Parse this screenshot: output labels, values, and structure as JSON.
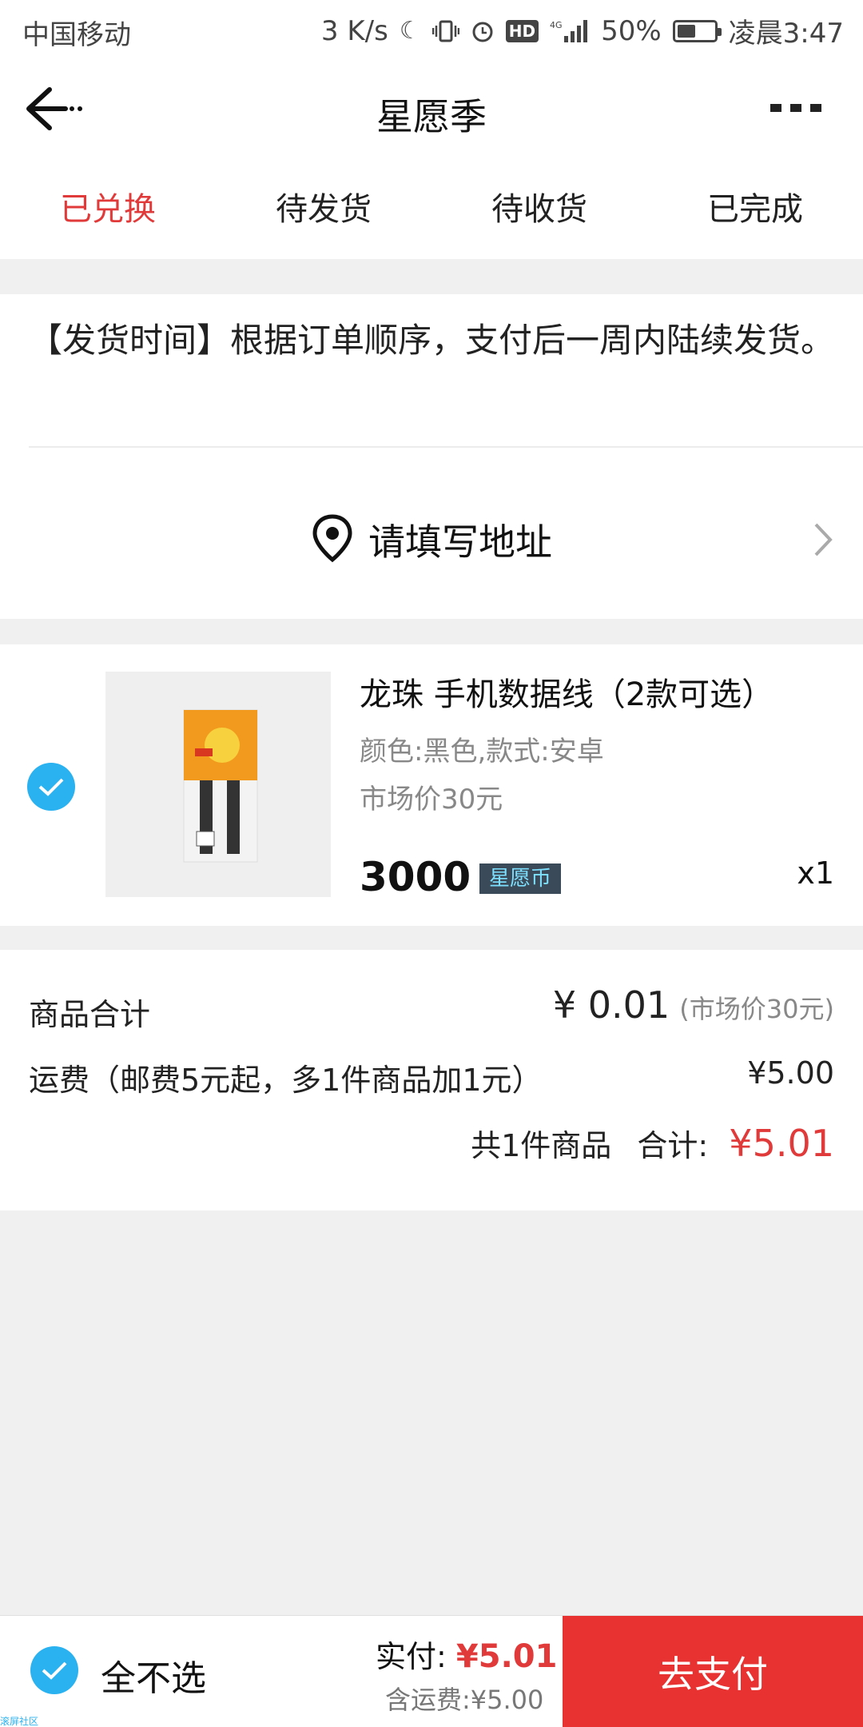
{
  "status_bar": {
    "carrier": "中国移动",
    "speed": "3 K/s",
    "hd": "HD",
    "network": "4G",
    "battery": "50%",
    "time": "凌晨3:47"
  },
  "header": {
    "title": "星愿季"
  },
  "tabs": [
    {
      "label": "已兑换",
      "active": true
    },
    {
      "label": "待发货",
      "active": false
    },
    {
      "label": "待收货",
      "active": false
    },
    {
      "label": "已完成",
      "active": false
    }
  ],
  "notice": "【发货时间】根据订单顺序，支付后一周内陆续发货。",
  "address": {
    "label": "请填写地址"
  },
  "product": {
    "name": "龙珠 手机数据线（2款可选）",
    "spec": "颜色:黑色,款式:安卓",
    "market_price": "市场价30元",
    "price": "3000",
    "currency_badge": "星愿币",
    "quantity": "x1"
  },
  "summary": {
    "goods_total_label": "商品合计",
    "goods_total_value": "¥ 0.01",
    "goods_total_market": "(市场价30元)",
    "shipping_label": "运费（邮费5元起，多1件商品加1元）",
    "shipping_value": "¥5.00",
    "count_text": "共1件商品",
    "total_label": "合计:",
    "total_value": "¥5.01"
  },
  "bottom_bar": {
    "select_all_label": "全不选",
    "paid_label": "实付:",
    "paid_value": "¥5.01",
    "shipping_note": "含运费:¥5.00",
    "pay_button": "去支付"
  },
  "watermark": "滚屏社区",
  "colors": {
    "accent_red": "#e13a3a",
    "pay_button": "#e83232",
    "check_blue": "#2ab1f0"
  }
}
